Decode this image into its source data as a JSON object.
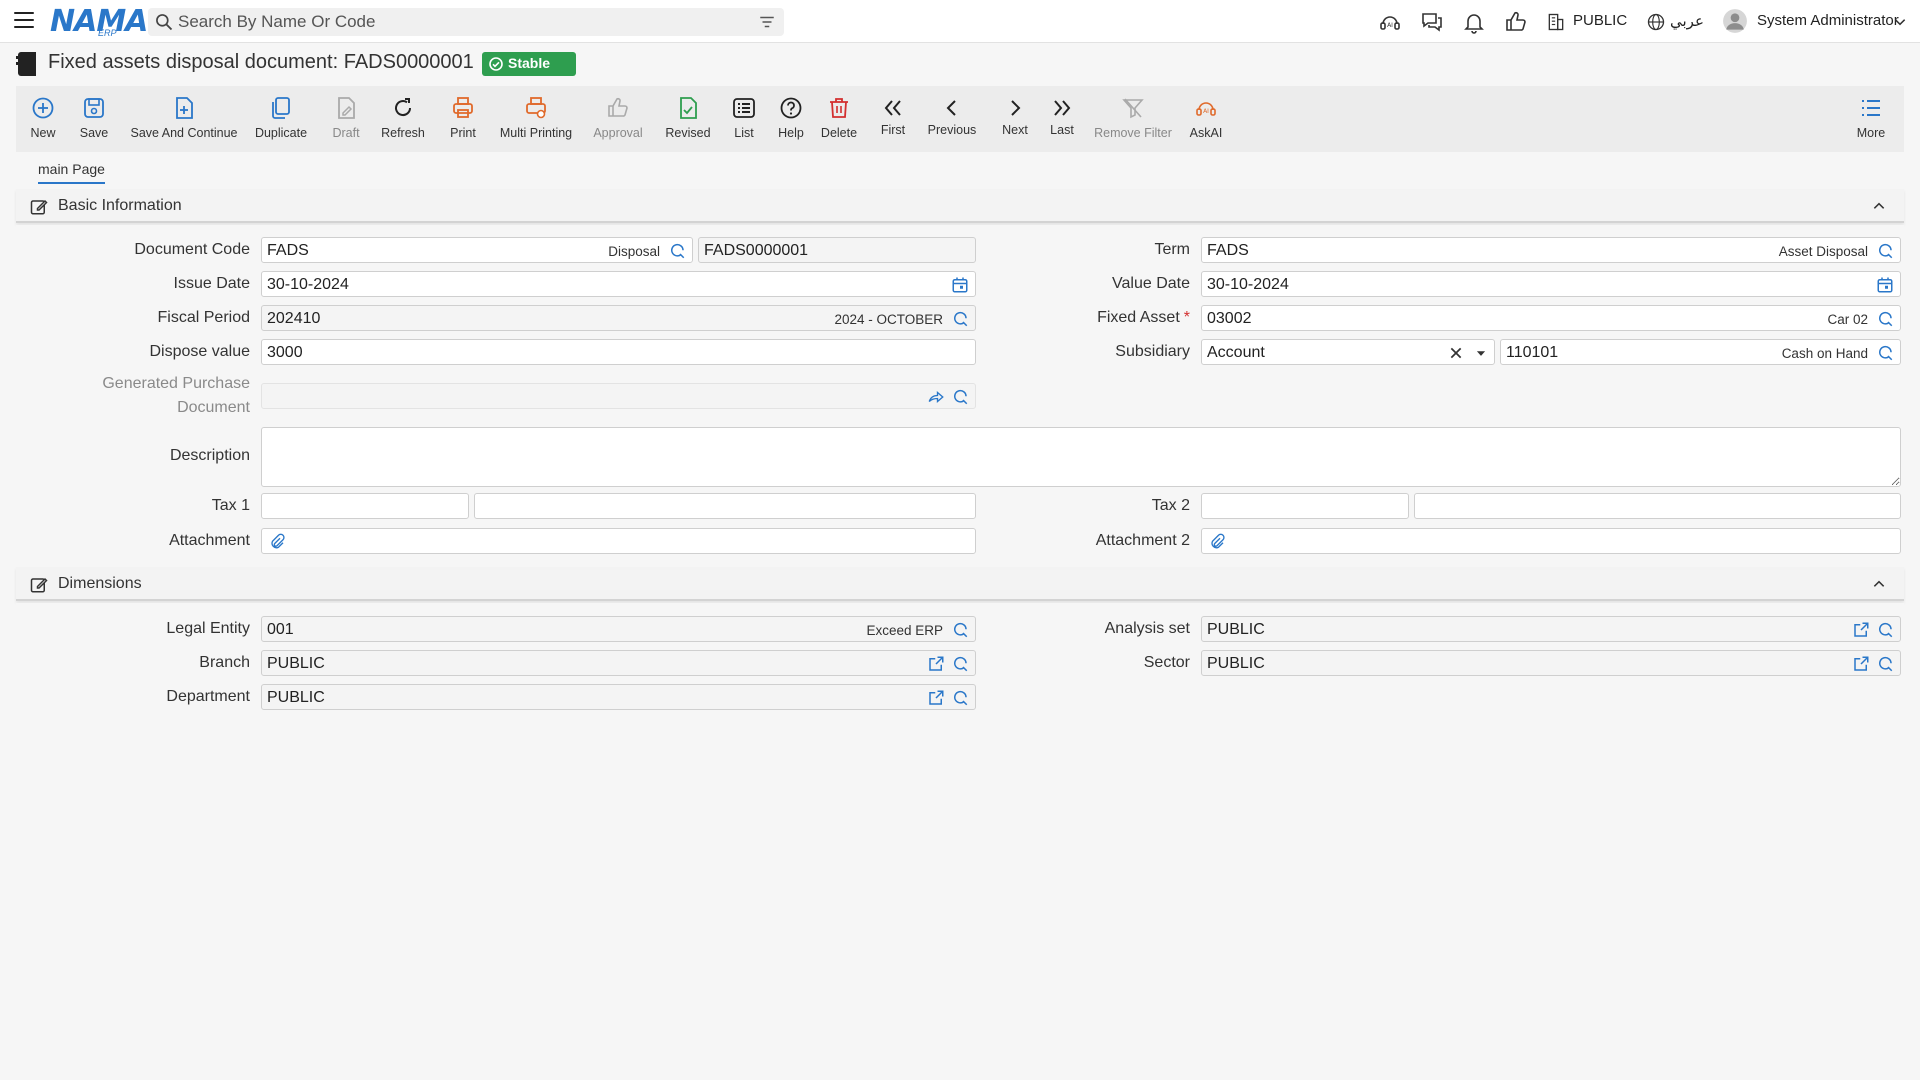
{
  "topbar": {
    "logo_main": "NAMA",
    "logo_sub": "ERP",
    "search_placeholder": "Search By Name Or Code",
    "company": "PUBLIC",
    "language": "عربي",
    "user": "System Administrator"
  },
  "page": {
    "title": "Fixed assets disposal document: FADS0000001",
    "status": "Stable"
  },
  "toolbar": [
    {
      "id": "new",
      "label": "New"
    },
    {
      "id": "save",
      "label": "Save"
    },
    {
      "id": "save-continue",
      "label": "Save And Continue"
    },
    {
      "id": "duplicate",
      "label": "Duplicate"
    },
    {
      "id": "draft",
      "label": "Draft"
    },
    {
      "id": "refresh",
      "label": "Refresh"
    },
    {
      "id": "print",
      "label": "Print"
    },
    {
      "id": "multi-print",
      "label": "Multi Printing"
    },
    {
      "id": "approval",
      "label": "Approval"
    },
    {
      "id": "revised",
      "label": "Revised"
    },
    {
      "id": "list",
      "label": "List"
    },
    {
      "id": "help",
      "label": "Help"
    },
    {
      "id": "delete",
      "label": "Delete"
    },
    {
      "id": "first",
      "label": "First"
    },
    {
      "id": "previous",
      "label": "Previous"
    },
    {
      "id": "next",
      "label": "Next"
    },
    {
      "id": "last",
      "label": "Last"
    },
    {
      "id": "remove-filter",
      "label": "Remove Filter"
    },
    {
      "id": "askai",
      "label": "AskAI"
    },
    {
      "id": "more",
      "label": "More"
    }
  ],
  "tabs": {
    "main": "main Page"
  },
  "basic": {
    "title": "Basic Information",
    "document_code": {
      "label": "Document Code",
      "value": "FADS",
      "desc": "Disposal",
      "code": "FADS0000001"
    },
    "term": {
      "label": "Term",
      "value": "FADS",
      "desc": "Asset Disposal"
    },
    "issue_date": {
      "label": "Issue Date",
      "value": "30-10-2024"
    },
    "value_date": {
      "label": "Value Date",
      "value": "30-10-2024"
    },
    "fiscal_period": {
      "label": "Fiscal Period",
      "value": "202410",
      "desc": "2024 - OCTOBER"
    },
    "fixed_asset": {
      "label": "Fixed Asset",
      "required": "*",
      "value": "03002",
      "desc": "Car 02"
    },
    "dispose_value": {
      "label": "Dispose value",
      "value": "3000"
    },
    "subsidiary": {
      "label": "Subsidiary",
      "type": "Account",
      "value": "110101",
      "desc": "Cash on Hand"
    },
    "generated_purchase": {
      "label_line1": "Generated Purchase",
      "label_line2": "Document",
      "value": ""
    },
    "description": {
      "label": "Description",
      "value": ""
    },
    "tax1": {
      "label": "Tax 1"
    },
    "tax2": {
      "label": "Tax 2"
    },
    "attachment": {
      "label": "Attachment"
    },
    "attachment2": {
      "label": "Attachment 2"
    }
  },
  "dimensions": {
    "title": "Dimensions",
    "legal_entity": {
      "label": "Legal Entity",
      "value": "001",
      "desc": "Exceed ERP"
    },
    "analysis_set": {
      "label": "Analysis set",
      "value": "PUBLIC"
    },
    "branch": {
      "label": "Branch",
      "value": "PUBLIC"
    },
    "sector": {
      "label": "Sector",
      "value": "PUBLIC"
    },
    "department": {
      "label": "Department",
      "value": "PUBLIC"
    }
  },
  "colors": {
    "accent": "#2a77c9",
    "success": "#2e9e4f",
    "print": "#e06a2b",
    "danger": "#d32f2f"
  }
}
